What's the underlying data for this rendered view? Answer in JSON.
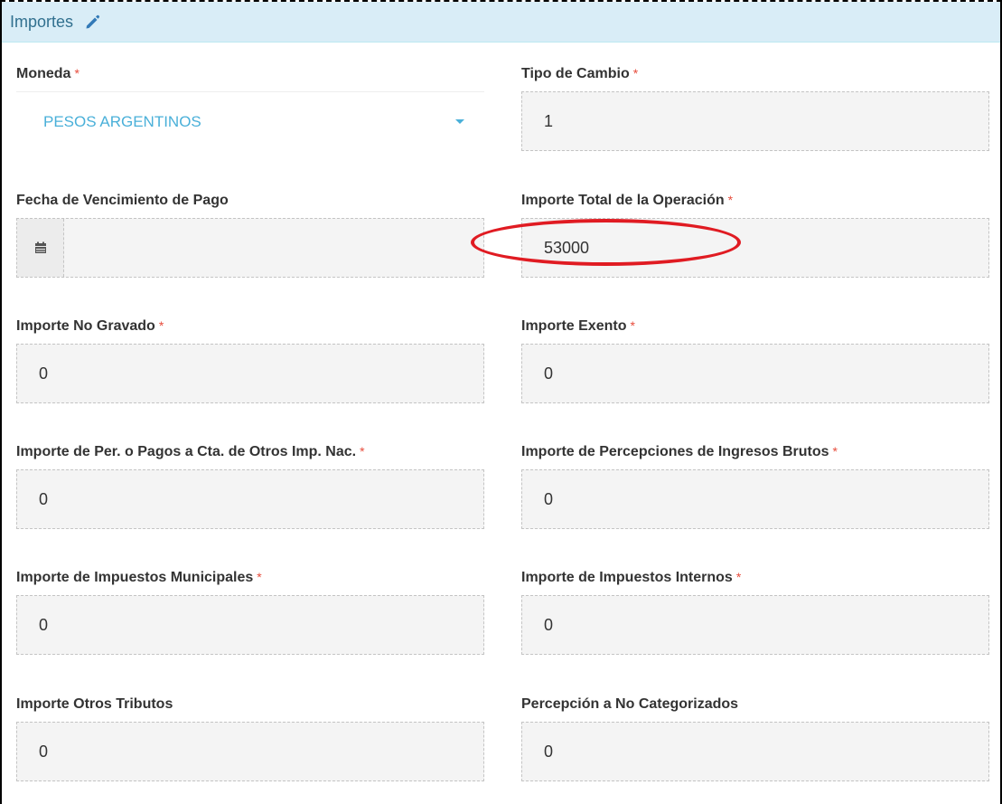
{
  "panel": {
    "title": "Importes",
    "edit_icon": "pencil-icon"
  },
  "required_mark": "*",
  "highlight_color": "#e01b22",
  "fields": {
    "moneda": {
      "label": "Moneda",
      "value": "PESOS ARGENTINOS"
    },
    "tipo_cambio": {
      "label": "Tipo de Cambio",
      "value": "1"
    },
    "fecha_vencimiento": {
      "label": "Fecha de Vencimiento de Pago",
      "value": "",
      "icon": "calendar-icon"
    },
    "importe_total": {
      "label": "Importe Total de la Operación",
      "value": "53000"
    },
    "no_gravado": {
      "label": "Importe No Gravado",
      "value": "0"
    },
    "exento": {
      "label": "Importe Exento",
      "value": "0"
    },
    "per_pagos_nac": {
      "label": "Importe de Per. o Pagos a Cta. de Otros Imp. Nac.",
      "value": "0"
    },
    "percep_iibb": {
      "label": "Importe de Percepciones de Ingresos Brutos",
      "value": "0"
    },
    "imp_municipales": {
      "label": "Importe de Impuestos Municipales",
      "value": "0"
    },
    "imp_internos": {
      "label": "Importe de Impuestos Internos",
      "value": "0"
    },
    "otros_tributos": {
      "label": "Importe Otros Tributos",
      "value": "0"
    },
    "percep_no_cat": {
      "label": "Percepción a No Categorizados",
      "value": "0"
    }
  }
}
